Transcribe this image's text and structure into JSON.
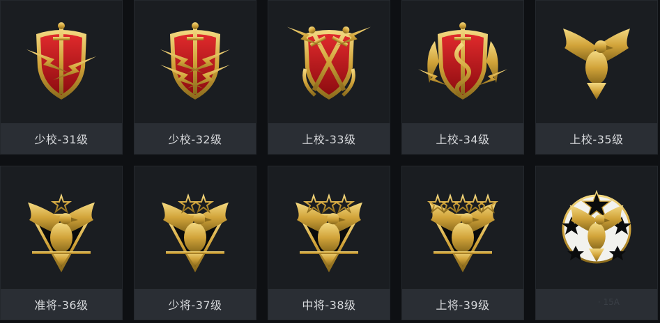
{
  "colors": {
    "gold": "#d9b44a",
    "gold_dark": "#8a6a1c",
    "red": "#c8141a",
    "card_bg": "#1a1d21",
    "label_bg": "#2a2e34",
    "label_text": "#d8dadd"
  },
  "ranks": [
    {
      "label": "少校-31级",
      "emblem": "red-shield-sword-lightning-icon",
      "stars": 0
    },
    {
      "label": "少校-32级",
      "emblem": "red-shield-sword-double-lightning-icon",
      "stars": 0
    },
    {
      "label": "上校-33级",
      "emblem": "red-shield-crossed-swords-icon",
      "stars": 0
    },
    {
      "label": "上校-34级",
      "emblem": "red-shield-winged-snake-sword-icon",
      "stars": 0
    },
    {
      "label": "上校-35级",
      "emblem": "gold-eagle-icon",
      "stars": 0
    },
    {
      "label": "准将-36级",
      "emblem": "eagle-shield-one-star-icon",
      "stars": 1
    },
    {
      "label": "少将-37级",
      "emblem": "eagle-shield-two-stars-icon",
      "stars": 2
    },
    {
      "label": "中将-38级",
      "emblem": "eagle-shield-three-stars-trident-icon",
      "stars": 3
    },
    {
      "label": "上将-39级",
      "emblem": "eagle-shield-five-stars-icon",
      "stars": 5
    },
    {
      "label": "",
      "emblem": "eagle-star-wreath-icon",
      "stars": 6
    }
  ],
  "watermark": {
    "text": "· 15A",
    "icon": "watermark-logo-icon"
  }
}
